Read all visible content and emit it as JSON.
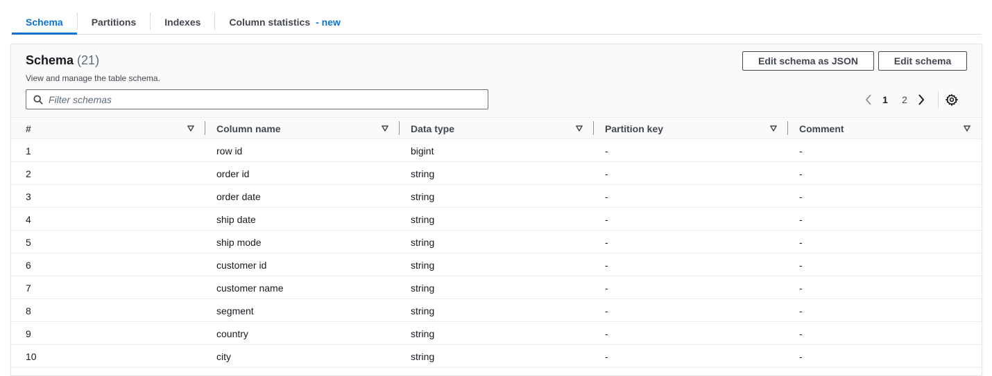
{
  "tabs": [
    {
      "label": "Schema",
      "active": true
    },
    {
      "label": "Partitions",
      "active": false
    },
    {
      "label": "Indexes",
      "active": false
    },
    {
      "label": "Column statistics",
      "badge": "- new",
      "active": false
    }
  ],
  "header": {
    "title": "Schema",
    "count": "(21)",
    "description": "View and manage the table schema.",
    "edit_json_label": "Edit schema as JSON",
    "edit_label": "Edit schema"
  },
  "filter": {
    "placeholder": "Filter schemas",
    "value": ""
  },
  "pagination": {
    "pages": [
      "1",
      "2"
    ],
    "current": "1"
  },
  "table": {
    "columns": [
      "#",
      "Column name",
      "Data type",
      "Partition key",
      "Comment"
    ],
    "rows": [
      [
        "1",
        "row id",
        "bigint",
        "-",
        "-"
      ],
      [
        "2",
        "order id",
        "string",
        "-",
        "-"
      ],
      [
        "3",
        "order date",
        "string",
        "-",
        "-"
      ],
      [
        "4",
        "ship date",
        "string",
        "-",
        "-"
      ],
      [
        "5",
        "ship mode",
        "string",
        "-",
        "-"
      ],
      [
        "6",
        "customer id",
        "string",
        "-",
        "-"
      ],
      [
        "7",
        "customer name",
        "string",
        "-",
        "-"
      ],
      [
        "8",
        "segment",
        "string",
        "-",
        "-"
      ],
      [
        "9",
        "country",
        "string",
        "-",
        "-"
      ],
      [
        "10",
        "city",
        "string",
        "-",
        "-"
      ]
    ]
  },
  "colors": {
    "accent": "#0972d3",
    "text": "#16191f",
    "muted": "#414750",
    "border": "#eaeded"
  }
}
